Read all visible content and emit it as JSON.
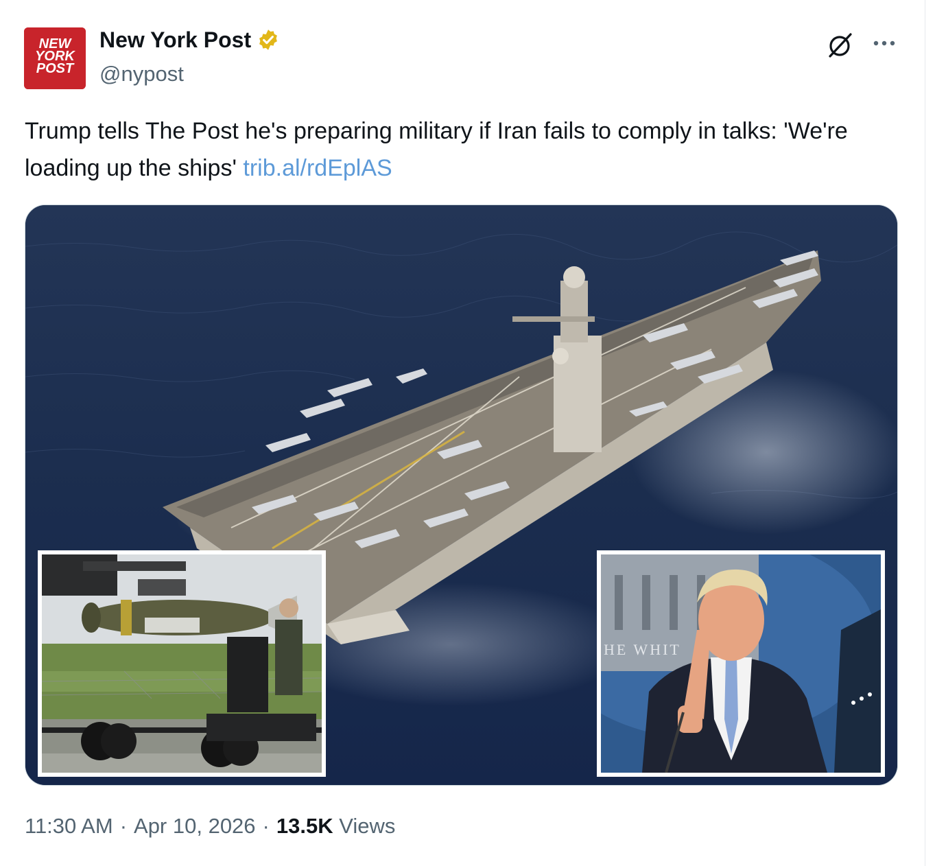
{
  "account": {
    "name": "New York Post",
    "handle": "@nypost",
    "avatar_lines": [
      "NEW",
      "YORK",
      "POST"
    ],
    "verified_color": "#e2b719"
  },
  "tweet": {
    "text": "Trump tells The Post he's preparing military if Iran fails to comply in talks: 'We're loading up the ships' ",
    "link": "trib.al/rdEplAS",
    "link_color": "#5d9ad8"
  },
  "header_actions": {
    "grok_icon": "grok-icon",
    "more_icon": "more-icon"
  },
  "media": {
    "main_subject": "aircraft carrier at sea",
    "inset_left_subject": "bomb loaded on munitions lift",
    "inset_right_subject": "man pointing at podium",
    "inset_right_wall_text": "HE WHIT"
  },
  "meta": {
    "time": "11:30 AM",
    "separator": "·",
    "date": "Apr 10, 2026",
    "views_count": "13.5K",
    "views_label": "Views"
  }
}
